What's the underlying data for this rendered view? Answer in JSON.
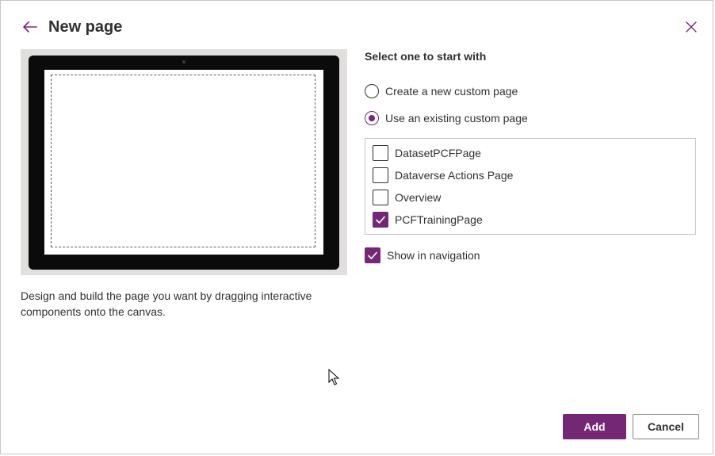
{
  "dialog": {
    "title": "New page",
    "description": "Design and build the page you want by dragging interactive components onto the canvas.",
    "section_label": "Select one to start with",
    "accent_color": "#742774",
    "icons": {
      "back": "arrow-left-icon",
      "close": "close-icon",
      "check": "checkmark-icon",
      "cursor": "mouse-pointer-icon"
    }
  },
  "options": {
    "create_new": {
      "label": "Create a new custom page",
      "selected": false
    },
    "use_existing": {
      "label": "Use an existing custom page",
      "selected": true
    }
  },
  "pages": [
    {
      "label": "DatasetPCFPage",
      "checked": false
    },
    {
      "label": "Dataverse Actions Page",
      "checked": false
    },
    {
      "label": "Overview",
      "checked": false
    },
    {
      "label": "PCFTrainingPage",
      "checked": true
    }
  ],
  "navigation": {
    "label": "Show in navigation",
    "checked": true
  },
  "buttons": {
    "add": "Add",
    "cancel": "Cancel"
  }
}
